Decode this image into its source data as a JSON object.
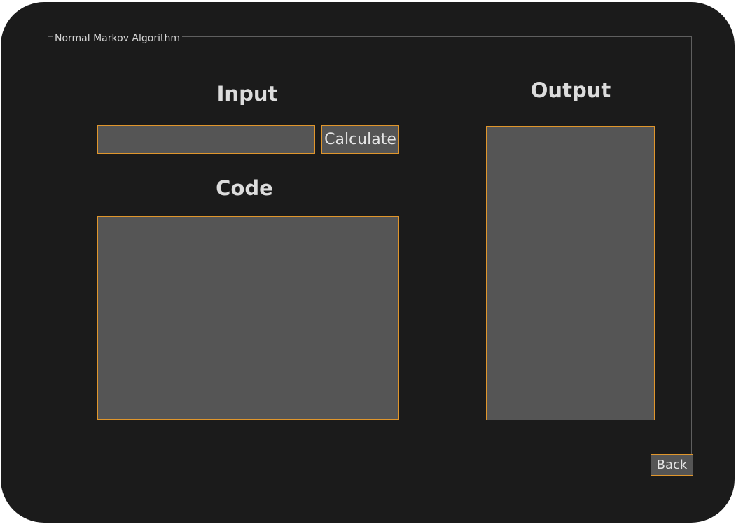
{
  "window": {
    "group_title": "Normal Markov Algorithm"
  },
  "input_section": {
    "heading": "Input",
    "input_value": "",
    "calculate_label": "Calculate"
  },
  "code_section": {
    "heading": "Code",
    "code_value": ""
  },
  "output_section": {
    "heading": "Output",
    "output_value": ""
  },
  "footer": {
    "back_label": "Back"
  },
  "colors": {
    "background": "#1b1b1b",
    "field_fill": "#555555",
    "accent_border": "#e0962c",
    "text": "#dcdcdc"
  }
}
